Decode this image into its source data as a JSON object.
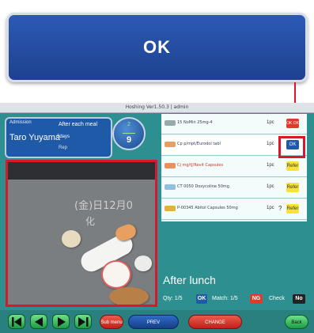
{
  "callout": {
    "label": "OK"
  },
  "window": {
    "title": "Hoshing Ver1.50.3 | admin"
  },
  "patient": {
    "top_left": "Admission",
    "timing": "After each meal",
    "name": "Taro Yuyama",
    "days": "3days",
    "sub": "Rep"
  },
  "counter": {
    "top": "2",
    "bottom": "9"
  },
  "photo": {
    "text_line1": "(金)日12月0",
    "text_line2": "化"
  },
  "drugs": [
    {
      "name": "15 NoMin 25mg-4",
      "qty": "1pc",
      "mark": "",
      "badge": "OK OK",
      "badge_color": "#e03a2a"
    },
    {
      "name": "Cp p/mpt/Eurodol tabl",
      "qty": "1pc",
      "mark": "",
      "badge": "OK",
      "badge_color": "#1f5aa8"
    },
    {
      "name": "Cj mg/tJ/Revit Capsules",
      "qty": "1pc",
      "mark": "",
      "badge": "Refer",
      "badge_color": "#f5e23a"
    },
    {
      "name": "CT 0050 Doxycoline 50mg",
      "qty": "1pc",
      "mark": "",
      "badge": "Refer",
      "badge_color": "#f5e23a"
    },
    {
      "name": "P-00345 Abitol Capsules 50mg",
      "qty": "1pc",
      "mark": "?",
      "badge": "Refer",
      "badge_color": "#f5e23a"
    }
  ],
  "meal": {
    "label": "After lunch"
  },
  "status": {
    "qty_label": "Qty: 1/5",
    "qty_badge": "OK",
    "match_label": "Match: 1/5",
    "match_badge": "NG",
    "check_label": "Check",
    "check_badge": "No"
  },
  "nav": {
    "sub_menu": "Sub menu",
    "prev_patient": "PREV",
    "change": "CHANGE",
    "back": "Back"
  }
}
